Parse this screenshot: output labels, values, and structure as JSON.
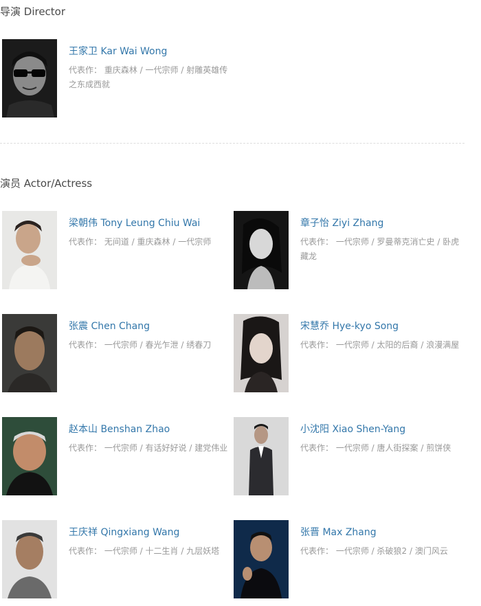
{
  "director_section": {
    "title": "导演 Director",
    "people": [
      {
        "name": "王家卫 Kar Wai Wong",
        "works_label": "代表作：",
        "works": "重庆森林 / 一代宗师 / 射雕英雄传之东成西就"
      }
    ]
  },
  "actor_section": {
    "title": "演员 Actor/Actress",
    "people": [
      {
        "name": "梁朝伟 Tony Leung Chiu Wai",
        "works_label": "代表作：",
        "works": "无间道 / 重庆森林 / 一代宗师"
      },
      {
        "name": "章子怡 Ziyi Zhang",
        "works_label": "代表作：",
        "works": "一代宗师 / 罗曼蒂克消亡史 / 卧虎藏龙"
      },
      {
        "name": "张震 Chen Chang",
        "works_label": "代表作：",
        "works": "一代宗师 / 春光乍泄 / 绣春刀"
      },
      {
        "name": "宋慧乔 Hye-kyo Song",
        "works_label": "代表作：",
        "works": "一代宗师 / 太阳的后裔 / 浪漫满屋"
      },
      {
        "name": "赵本山 Benshan Zhao",
        "works_label": "代表作：",
        "works": "一代宗师 / 有话好好说 / 建党伟业"
      },
      {
        "name": "小沈阳 Xiao Shen-Yang",
        "works_label": "代表作：",
        "works": "一代宗师 / 唐人街探案 / 煎饼侠"
      },
      {
        "name": "王庆祥 Qingxiang Wang",
        "works_label": "代表作：",
        "works": "一代宗师 / 十二生肖 / 九层妖塔"
      },
      {
        "name": "张晋 Max Zhang",
        "works_label": "代表作：",
        "works": "一代宗师 / 杀破狼2 / 澳门风云"
      }
    ]
  },
  "colors": {
    "link": "#3377aa",
    "meta": "#999999",
    "title": "#494949"
  }
}
